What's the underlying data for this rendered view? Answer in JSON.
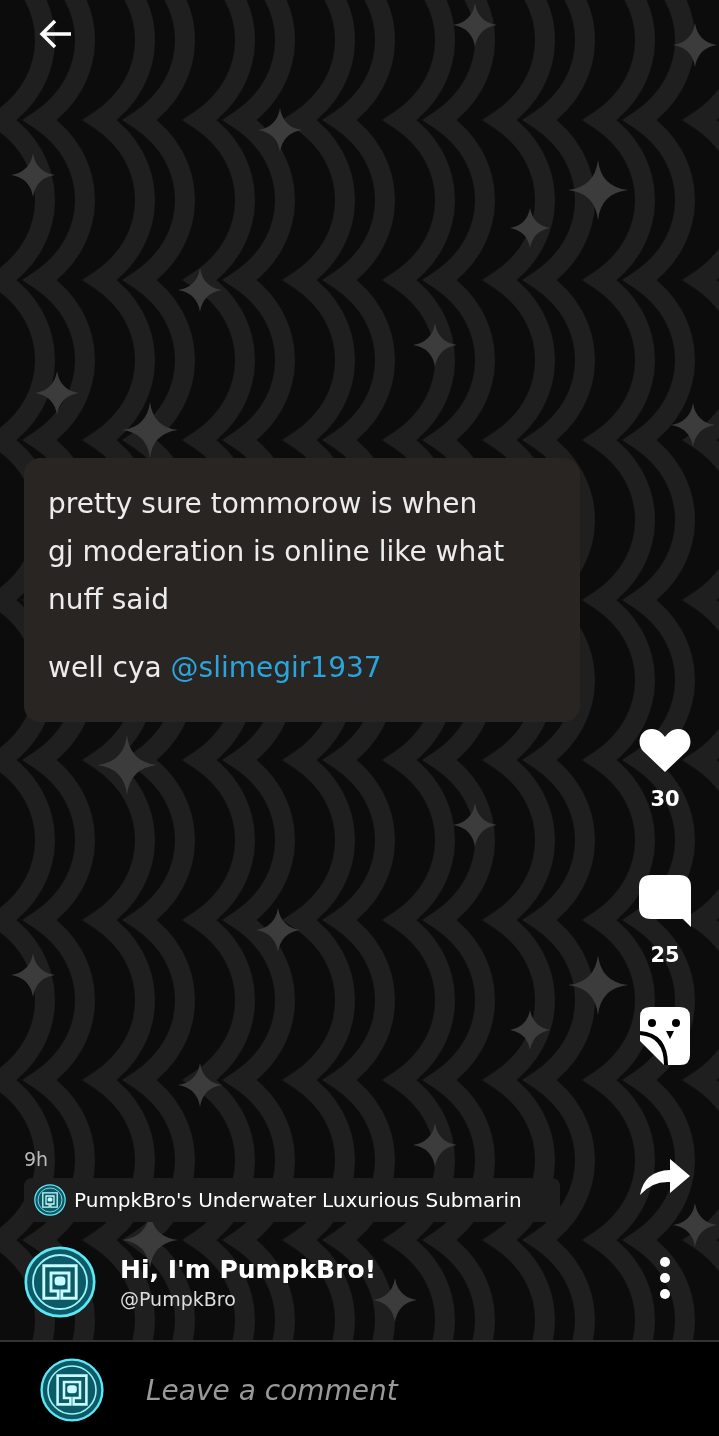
{
  "post": {
    "paragraphs": [
      "pretty sure tommorow is when gj moderation is online like what nuff said"
    ],
    "closing": {
      "text": "well cya",
      "mention": "@slimegir1937"
    },
    "time": "9h",
    "community": "PumpkBro's Underwater Luxurious Submarin",
    "author": {
      "title": "Hi, I'm PumpkBro!",
      "handle": "@PumpkBro"
    }
  },
  "actions": [
    {
      "kind": "like",
      "count": "30"
    },
    {
      "kind": "comment",
      "count": "25"
    },
    {
      "kind": "sticker"
    },
    {
      "kind": "share"
    }
  ],
  "comment_bar": {
    "placeholder": "Leave a comment"
  }
}
